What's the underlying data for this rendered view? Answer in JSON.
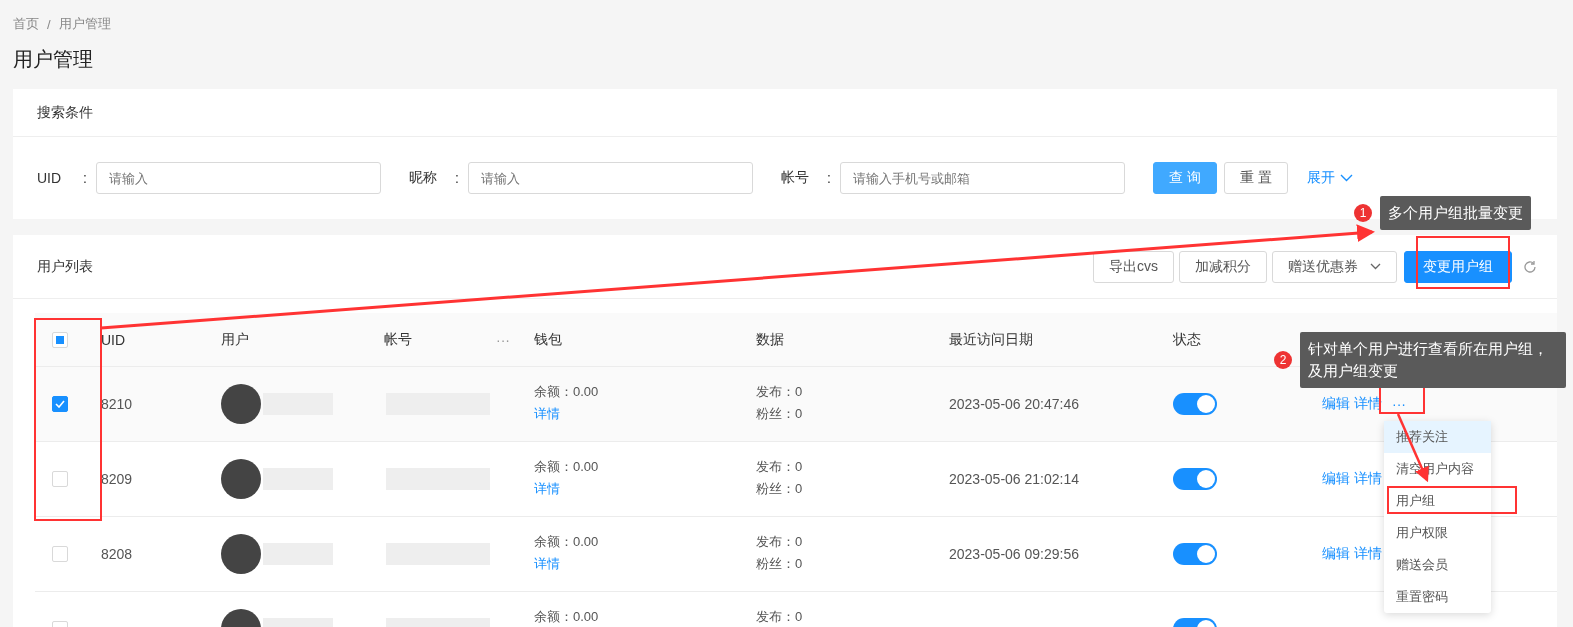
{
  "breadcrumb": [
    "首页",
    "用户管理"
  ],
  "breadcrumb_separator": "/",
  "page_title": "用户管理",
  "search": {
    "title": "搜索条件",
    "fields": [
      {
        "label": "UID",
        "colon": ":",
        "placeholder": "请输入"
      },
      {
        "label": "昵称",
        "colon": ":",
        "placeholder": "请输入"
      },
      {
        "label": "帐号",
        "colon": ":",
        "placeholder": "请输入手机号或邮箱"
      }
    ],
    "buttons": [
      {
        "label": "查 询",
        "kind": "primary"
      },
      {
        "label": "重 置",
        "kind": "default"
      }
    ],
    "expand": "展开"
  },
  "list": {
    "title": "用户列表",
    "toolbar": [
      {
        "label": "导出cvs",
        "kind": "default"
      },
      {
        "label": "加减积分",
        "kind": "default"
      },
      {
        "label": "赠送优惠券",
        "kind": "dropdown"
      },
      {
        "label": "变更用户组",
        "kind": "primary"
      }
    ],
    "header_checkbox": {
      "indeterminate": true
    },
    "columns": [
      "UID",
      "用户",
      "帐号",
      "钱包",
      "数据",
      "最近访问日期",
      "状态"
    ],
    "column_more": "···",
    "rows": [
      {
        "uid": "8210",
        "checked": true,
        "balance": "余额：0.00",
        "wallet_link": "详情",
        "posts": "发布：0",
        "fans": "粉丝：0",
        "date": "2023-05-06 20:47:46",
        "on": true,
        "actions": [
          "编辑",
          "详情"
        ],
        "more": "···"
      },
      {
        "uid": "8209",
        "checked": false,
        "balance": "余额：0.00",
        "wallet_link": "详情",
        "posts": "发布：0",
        "fans": "粉丝：0",
        "date": "2023-05-06 21:02:14",
        "on": true,
        "actions": [
          "编辑",
          "详情"
        ]
      },
      {
        "uid": "8208",
        "checked": false,
        "balance": "余额：0.00",
        "wallet_link": "详情",
        "posts": "发布：0",
        "fans": "粉丝：0",
        "date": "2023-05-06 09:29:56",
        "on": true,
        "actions": [
          "编辑",
          "详情"
        ]
      },
      {
        "uid": "",
        "checked": false,
        "balance": "余额：0.00",
        "posts": "发布：0",
        "on": true
      }
    ]
  },
  "menu": [
    {
      "label": "推荐关注",
      "selected": true
    },
    {
      "label": "清空用户内容",
      "selected": false
    },
    {
      "label": "用户组",
      "selected": false
    },
    {
      "label": "用户权限",
      "selected": false
    },
    {
      "label": "赠送会员",
      "selected": false
    },
    {
      "label": "重置密码",
      "selected": false
    }
  ],
  "callouts": [
    {
      "number": "1",
      "text": "多个用户组批量变更"
    },
    {
      "number": "2",
      "text": "针对单个用户进行查看所在用户组，及用户组变更"
    }
  ]
}
